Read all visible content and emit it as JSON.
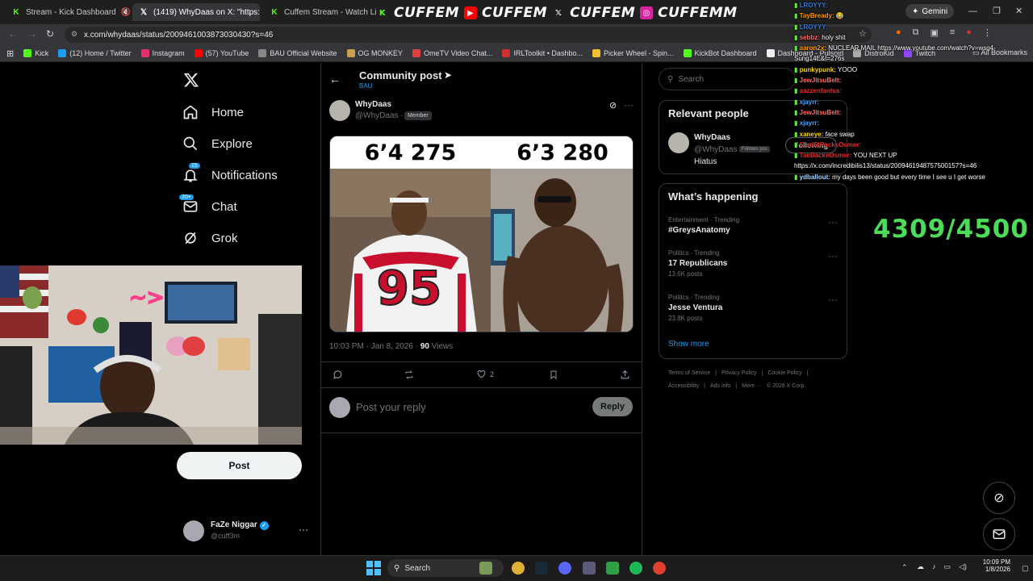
{
  "browser": {
    "tabs": [
      {
        "title": "Stream - Kick Dashboard"
      },
      {
        "title": "(1419) WhyDaas on X: \"https://"
      },
      {
        "title": "Cuffem Stream - Watch Live on"
      }
    ],
    "url": "x.com/whydaas/status/2009461003873030430?s=46",
    "gemini_label": "Gemini",
    "bookmarks": [
      {
        "label": "Kick",
        "color": "#53fc18"
      },
      {
        "label": "(12) Home / Twitter",
        "color": "#1d9bf0"
      },
      {
        "label": "Instagram",
        "color": "#e1306c"
      },
      {
        "label": "(57) YouTube",
        "color": "#ff0000"
      },
      {
        "label": "BAU Official Website",
        "color": "#888888"
      },
      {
        "label": "OG MONKEY",
        "color": "#c8a050"
      },
      {
        "label": "OmeTV Video Chat...",
        "color": "#e04040"
      },
      {
        "label": "IRLToolkit • Dashbo...",
        "color": "#d03030"
      },
      {
        "label": "Picker Wheel - Spin...",
        "color": "#f0c030"
      },
      {
        "label": "KickBot Dashboard",
        "color": "#53fc18"
      },
      {
        "label": "Dashboard - Pulsoid",
        "color": "#eeeeee"
      },
      {
        "label": "DistroKid",
        "color": "#aaaaaa"
      },
      {
        "label": "Twitch",
        "color": "#9146ff"
      }
    ],
    "all_bookmarks": "All Bookmarks"
  },
  "banner": {
    "text": [
      "CUFFEM",
      "CUFFEM",
      "CUFFEM",
      "CUFFEMM"
    ]
  },
  "nav": {
    "items": [
      {
        "label": "Home"
      },
      {
        "label": "Explore"
      },
      {
        "label": "Notifications",
        "badge": "15"
      },
      {
        "label": "Chat",
        "badge": "20+"
      },
      {
        "label": "Grok"
      }
    ],
    "post_button": "Post",
    "account": {
      "name": "FaZe Niggar",
      "handle": "@cuff3m"
    }
  },
  "post": {
    "header_title": "Community post",
    "header_sub": "BAU",
    "author_name": "WhyDaas",
    "author_handle": "@WhyDaas ·",
    "member_badge": "Member",
    "media_left_label": "6’4 275",
    "media_right_label": "6’3 280",
    "jersey_number": "95",
    "timestamp": "10:03 PM · Jan 8, 2026 ·",
    "views_count": "90",
    "views_label": "Views",
    "likes": "2",
    "reply_placeholder": "Post your reply",
    "reply_button": "Reply"
  },
  "right": {
    "search_placeholder": "Search",
    "relevant_title": "Relevant people",
    "person": {
      "name": "WhyDaas",
      "handle": "@WhyDaas",
      "follows_you": "Follows you",
      "bio": "Hiatus",
      "button": "Following"
    },
    "happening_title": "What’s happening",
    "trends": [
      {
        "category": "Entertainment · Trending",
        "title": "#GreysAnatomy",
        "posts": ""
      },
      {
        "category": "Politics · Trending",
        "title": "17 Republicans",
        "posts": "13.6K posts"
      },
      {
        "category": "Politics · Trending",
        "title": "Jesse Ventura",
        "posts": "23.8K posts"
      }
    ],
    "show_more": "Show more",
    "footer_line1": [
      "Terms of Service",
      "|",
      "Privacy Policy",
      "|",
      "Cookie Policy",
      "|"
    ],
    "footer_line2": [
      "Accessibility",
      "|",
      "Ads info",
      "|",
      "More ···",
      "© 2026 X Corp."
    ]
  },
  "chat": [
    {
      "user": "LROYYY:",
      "msg": "",
      "color": "#3a7bd5"
    },
    {
      "user": "TayBready:",
      "msg": "😂",
      "color": "#ff9900"
    },
    {
      "user": "LROYYY:",
      "msg": "",
      "color": "#3a7bd5"
    },
    {
      "user": "sebbz:",
      "msg": "holy shit",
      "color": "#ff6b6b"
    },
    {
      "user": "aaron2x:",
      "msg": "NUCLEAR MAIL https://www.youtube.com/watch?v=wsg4-Sung14E&t=276s",
      "color": "#ff9900"
    },
    {
      "user": "punkypunk:",
      "msg": "YOOO",
      "color": "#ffd700"
    },
    {
      "user": "JewJitsuBelt:",
      "msg": "",
      "color": "#ff6b6b"
    },
    {
      "user": "aazzenfantss:",
      "msg": "",
      "color": "#e03030"
    },
    {
      "user": "xjayrr:",
      "msg": "",
      "color": "#4aa3ff"
    },
    {
      "user": "JewJitsuBelt:",
      "msg": "",
      "color": "#ff6b6b"
    },
    {
      "user": "xjayrr:",
      "msg": "",
      "color": "#4aa3ff"
    },
    {
      "user": "xaneye:",
      "msg": "face swap",
      "color": "#ffd700"
    },
    {
      "user": "ClsdStPacksOsmer:",
      "msg": "",
      "color": "#e03030"
    },
    {
      "user": "TaeBackeOsmer:",
      "msg": "YOU NEXT UP https://x.com/incredibilis13/status/2009461948757500157?s=46",
      "color": "#e03030"
    },
    {
      "user": "ydballout:",
      "msg": "my days been good but every time I see u I get worse",
      "color": "#9fd6ff"
    }
  ],
  "counter": "4309/4500",
  "taskbar": {
    "search": "Search",
    "time": "10:09 PM",
    "date": "1/8/2026"
  }
}
